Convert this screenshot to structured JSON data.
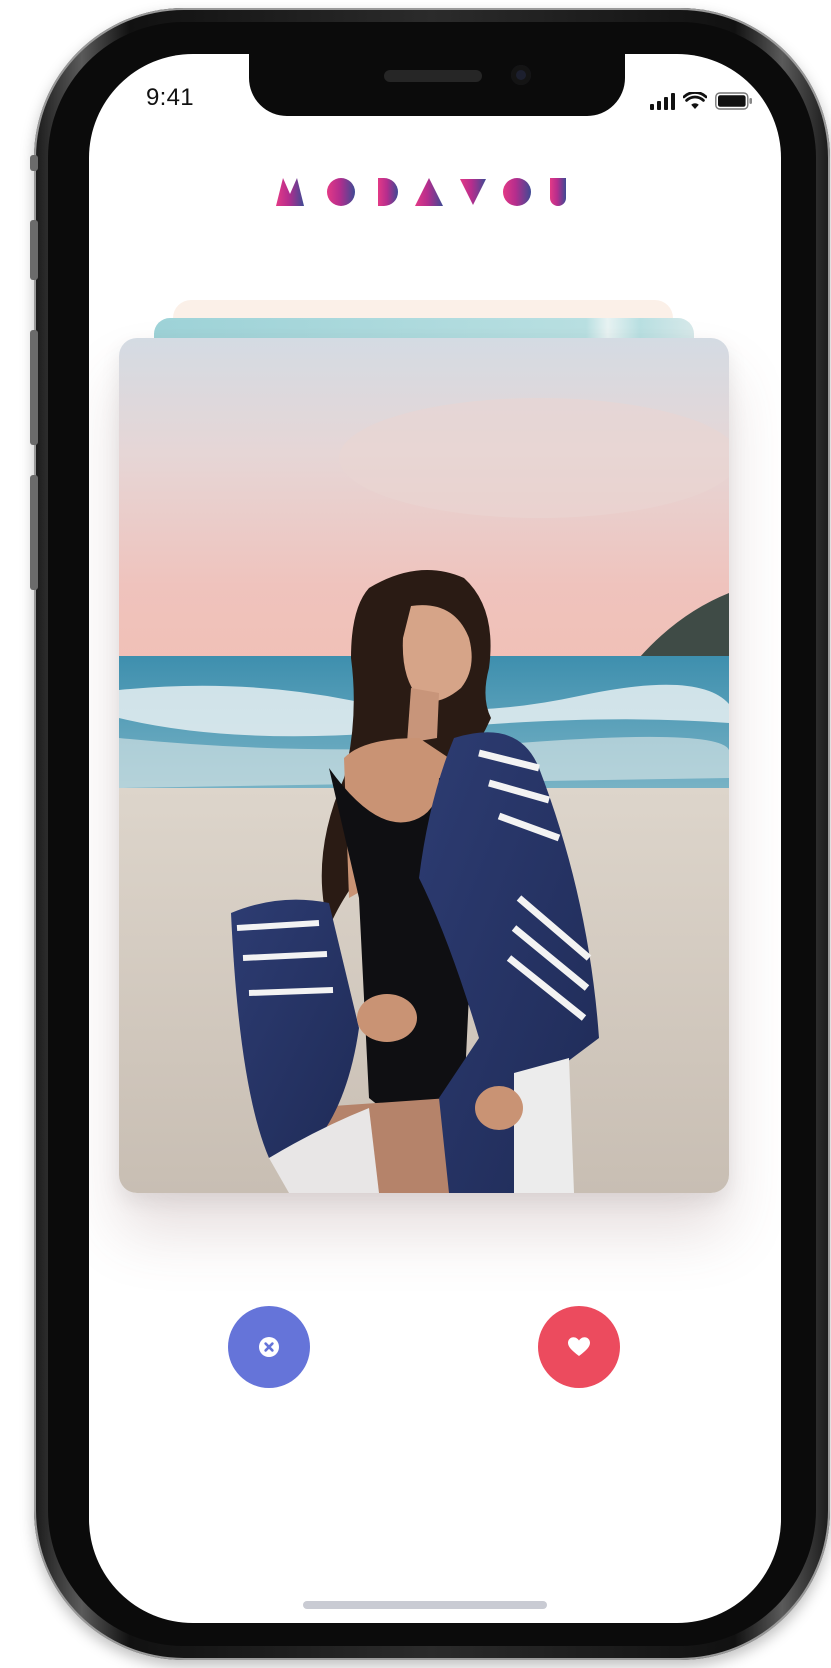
{
  "status_bar": {
    "time": "9:41"
  },
  "brand": {
    "logo_letters": [
      "M",
      "O",
      "D",
      "A",
      "V",
      "O",
      "U"
    ],
    "gradient": [
      "#e8317a",
      "#3f4a94"
    ]
  },
  "card": {
    "photo_description_icon": "photo-of-person-on-beach"
  },
  "actions": {
    "dislike_icon": "close-icon",
    "dislike_color": "#6574d9",
    "like_icon": "heart-icon",
    "like_color": "#ec4b5e"
  }
}
